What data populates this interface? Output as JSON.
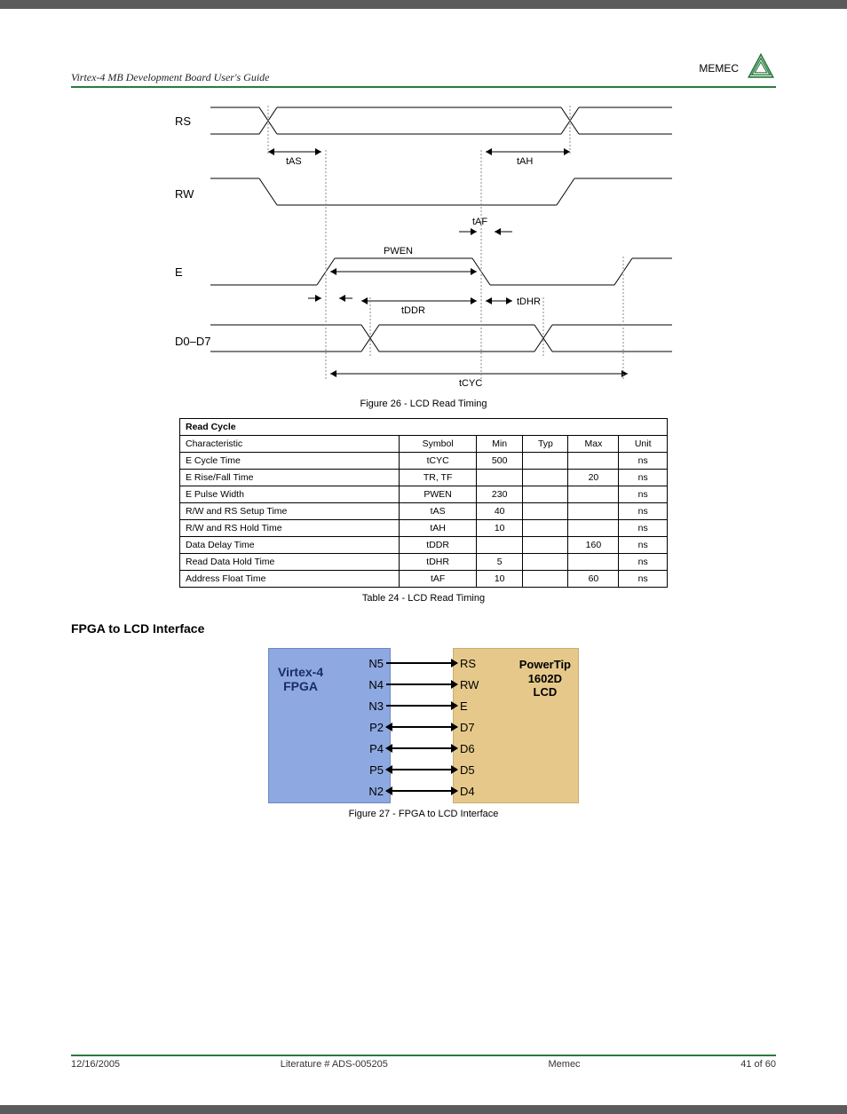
{
  "header": {
    "left": "Virtex-4 MB Development Board User's Guide",
    "right_brand": "MEMEC"
  },
  "timing": {
    "signals": [
      "RS",
      "RW",
      "E",
      "D0–D7"
    ],
    "labels": {
      "tas": "tAS",
      "tah": "tAH",
      "taf": "tAF",
      "pwen": "PWEN",
      "tddr": "tDDR",
      "tdhr": "tDHR",
      "tcyc": "tCYC"
    },
    "figure_caption": "Figure 26 - LCD Read Timing"
  },
  "read_cycle_table": {
    "title": "Read Cycle",
    "headers": [
      "Characteristic",
      "Symbol",
      "Min",
      "Typ",
      "Max",
      "Unit"
    ],
    "rows": [
      [
        "E Cycle Time",
        "tCYC",
        "500",
        "",
        "",
        "ns"
      ],
      [
        "E Rise/Fall Time",
        "TR, TF",
        "",
        "",
        "20",
        "ns"
      ],
      [
        "E Pulse Width",
        "PWEN",
        "230",
        "",
        "",
        "ns"
      ],
      [
        "R/W and RS Setup Time",
        "tAS",
        "40",
        "",
        "",
        "ns"
      ],
      [
        "R/W and RS Hold Time",
        "tAH",
        "10",
        "",
        "",
        "ns"
      ],
      [
        "Data Delay Time",
        "tDDR",
        "",
        "",
        "160",
        "ns"
      ],
      [
        "Read Data Hold Time",
        "tDHR",
        "5",
        "",
        "",
        "ns"
      ],
      [
        "Address Float Time",
        "tAF",
        "10",
        "",
        "60",
        "ns"
      ]
    ],
    "caption": "Table 24 - LCD Read Timing"
  },
  "section": {
    "title": "FPGA to LCD Interface"
  },
  "block_diagram": {
    "fpga": {
      "label_line1": "Virtex-4",
      "label_line2": "FPGA"
    },
    "lcd": {
      "label_line1": "PowerTip",
      "label_line2": "1602D",
      "label_line3": "LCD"
    },
    "connections": [
      {
        "src": "N5",
        "dst": "RS",
        "dir": "right"
      },
      {
        "src": "N4",
        "dst": "RW",
        "dir": "right"
      },
      {
        "src": "N3",
        "dst": "E",
        "dir": "right"
      },
      {
        "src": "P2",
        "dst": "D7",
        "dir": "both"
      },
      {
        "src": "P4",
        "dst": "D6",
        "dir": "both"
      },
      {
        "src": "P5",
        "dst": "D5",
        "dir": "both"
      },
      {
        "src": "N2",
        "dst": "D4",
        "dir": "both"
      }
    ],
    "caption": "Figure 27 - FPGA to LCD Interface"
  },
  "footer": {
    "left": "12/16/2005",
    "center_1": "Literature # ADS-005205",
    "center_2": "Memec",
    "right": "41 of 60"
  }
}
